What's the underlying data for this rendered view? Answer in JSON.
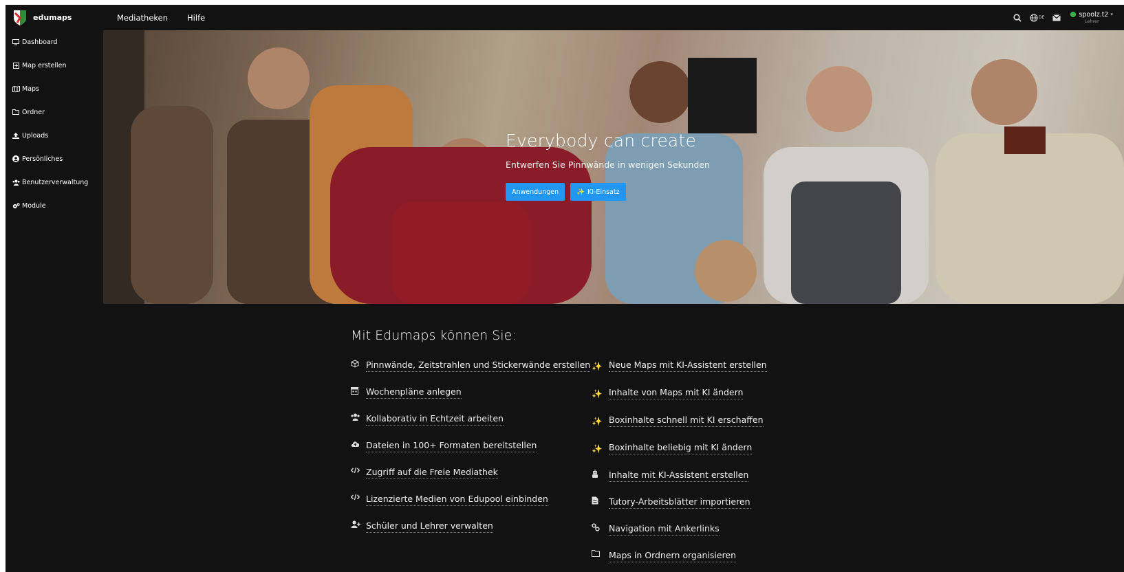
{
  "app": {
    "brand": "edumaps"
  },
  "topnav": {
    "items": [
      "Mediatheken",
      "Hilfe"
    ]
  },
  "topright": {
    "lang": "DE",
    "user_name": "spoolz.t2",
    "user_role": "Lehrer"
  },
  "sidebar": {
    "items": [
      {
        "label": "Dashboard",
        "icon": "monitor-icon"
      },
      {
        "label": "Map erstellen",
        "icon": "plus-square-icon"
      },
      {
        "label": "Maps",
        "icon": "map-icon"
      },
      {
        "label": "Ordner",
        "icon": "folder-icon"
      },
      {
        "label": "Uploads",
        "icon": "upload-icon"
      },
      {
        "label": "Persönliches",
        "icon": "user-circle-icon"
      },
      {
        "label": "Benutzerverwaltung",
        "icon": "users-icon"
      },
      {
        "label": "Module",
        "icon": "cogs-icon"
      }
    ]
  },
  "hero": {
    "title": "Everybody can create",
    "subtitle": "Entwerfen Sie Pinnwände in wenigen Sekunden",
    "btn_primary": "Anwendungen",
    "btn_ai": "KI-Einsatz"
  },
  "features": {
    "title": "Mit Edumaps können Sie:",
    "left": [
      {
        "text": "Pinnwände, Zeitstrahlen und Stickerwände erstellen",
        "icon": "cube-icon"
      },
      {
        "text": "Wochenpläne anlegen",
        "icon": "calendar-icon"
      },
      {
        "text": "Kollaborativ in Echtzeit arbeiten",
        "icon": "users-icon"
      },
      {
        "text": "Dateien in 100+ Formaten bereitstellen",
        "icon": "cloud-upload-icon"
      },
      {
        "text": "Zugriff auf die Freie Mediathek",
        "icon": "code-icon"
      },
      {
        "text": "Lizenzierte Medien von Edupool einbinden",
        "icon": "code-icon"
      },
      {
        "text": "Schüler und Lehrer verwalten",
        "icon": "user-plus-icon"
      }
    ],
    "right": [
      {
        "text": "Neue Maps mit KI-Assistent erstellen",
        "icon": "sparkle-icon"
      },
      {
        "text": "Inhalte von Maps mit KI ändern",
        "icon": "sparkle-icon"
      },
      {
        "text": "Boxinhalte schnell mit KI erschaffen",
        "icon": "sparkle-icon"
      },
      {
        "text": "Boxinhalte beliebig mit KI ändern",
        "icon": "sparkle-icon"
      },
      {
        "text": "Inhalte mit KI-Assistent erstellen",
        "icon": "robot-icon"
      },
      {
        "text": "Tutory-Arbeitsblätter importieren",
        "icon": "file-icon"
      },
      {
        "text": "Navigation mit Ankerlinks",
        "icon": "link-icon"
      },
      {
        "text": "Maps in Ordnern organisieren",
        "icon": "folder-icon"
      }
    ]
  },
  "colors": {
    "bg": "#121212",
    "accent": "#2196f3",
    "spark": "#f7b731",
    "online": "#38b54a"
  }
}
